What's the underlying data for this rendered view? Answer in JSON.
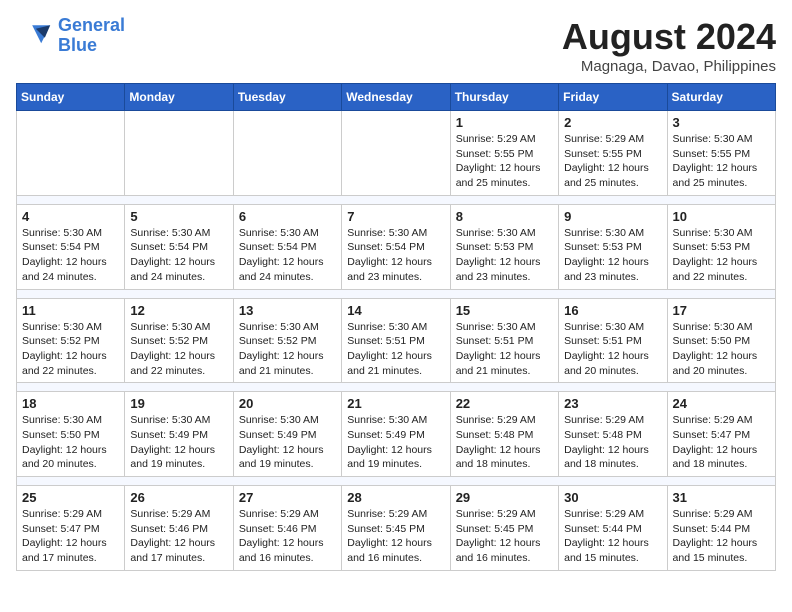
{
  "header": {
    "logo_line1": "General",
    "logo_line2": "Blue",
    "month_year": "August 2024",
    "location": "Magnaga, Davao, Philippines"
  },
  "weekdays": [
    "Sunday",
    "Monday",
    "Tuesday",
    "Wednesday",
    "Thursday",
    "Friday",
    "Saturday"
  ],
  "weeks": [
    {
      "days": [
        {
          "num": "",
          "info": ""
        },
        {
          "num": "",
          "info": ""
        },
        {
          "num": "",
          "info": ""
        },
        {
          "num": "",
          "info": ""
        },
        {
          "num": "1",
          "info": "Sunrise: 5:29 AM\nSunset: 5:55 PM\nDaylight: 12 hours\nand 25 minutes."
        },
        {
          "num": "2",
          "info": "Sunrise: 5:29 AM\nSunset: 5:55 PM\nDaylight: 12 hours\nand 25 minutes."
        },
        {
          "num": "3",
          "info": "Sunrise: 5:30 AM\nSunset: 5:55 PM\nDaylight: 12 hours\nand 25 minutes."
        }
      ]
    },
    {
      "days": [
        {
          "num": "4",
          "info": "Sunrise: 5:30 AM\nSunset: 5:54 PM\nDaylight: 12 hours\nand 24 minutes."
        },
        {
          "num": "5",
          "info": "Sunrise: 5:30 AM\nSunset: 5:54 PM\nDaylight: 12 hours\nand 24 minutes."
        },
        {
          "num": "6",
          "info": "Sunrise: 5:30 AM\nSunset: 5:54 PM\nDaylight: 12 hours\nand 24 minutes."
        },
        {
          "num": "7",
          "info": "Sunrise: 5:30 AM\nSunset: 5:54 PM\nDaylight: 12 hours\nand 23 minutes."
        },
        {
          "num": "8",
          "info": "Sunrise: 5:30 AM\nSunset: 5:53 PM\nDaylight: 12 hours\nand 23 minutes."
        },
        {
          "num": "9",
          "info": "Sunrise: 5:30 AM\nSunset: 5:53 PM\nDaylight: 12 hours\nand 23 minutes."
        },
        {
          "num": "10",
          "info": "Sunrise: 5:30 AM\nSunset: 5:53 PM\nDaylight: 12 hours\nand 22 minutes."
        }
      ]
    },
    {
      "days": [
        {
          "num": "11",
          "info": "Sunrise: 5:30 AM\nSunset: 5:52 PM\nDaylight: 12 hours\nand 22 minutes."
        },
        {
          "num": "12",
          "info": "Sunrise: 5:30 AM\nSunset: 5:52 PM\nDaylight: 12 hours\nand 22 minutes."
        },
        {
          "num": "13",
          "info": "Sunrise: 5:30 AM\nSunset: 5:52 PM\nDaylight: 12 hours\nand 21 minutes."
        },
        {
          "num": "14",
          "info": "Sunrise: 5:30 AM\nSunset: 5:51 PM\nDaylight: 12 hours\nand 21 minutes."
        },
        {
          "num": "15",
          "info": "Sunrise: 5:30 AM\nSunset: 5:51 PM\nDaylight: 12 hours\nand 21 minutes."
        },
        {
          "num": "16",
          "info": "Sunrise: 5:30 AM\nSunset: 5:51 PM\nDaylight: 12 hours\nand 20 minutes."
        },
        {
          "num": "17",
          "info": "Sunrise: 5:30 AM\nSunset: 5:50 PM\nDaylight: 12 hours\nand 20 minutes."
        }
      ]
    },
    {
      "days": [
        {
          "num": "18",
          "info": "Sunrise: 5:30 AM\nSunset: 5:50 PM\nDaylight: 12 hours\nand 20 minutes."
        },
        {
          "num": "19",
          "info": "Sunrise: 5:30 AM\nSunset: 5:49 PM\nDaylight: 12 hours\nand 19 minutes."
        },
        {
          "num": "20",
          "info": "Sunrise: 5:30 AM\nSunset: 5:49 PM\nDaylight: 12 hours\nand 19 minutes."
        },
        {
          "num": "21",
          "info": "Sunrise: 5:30 AM\nSunset: 5:49 PM\nDaylight: 12 hours\nand 19 minutes."
        },
        {
          "num": "22",
          "info": "Sunrise: 5:29 AM\nSunset: 5:48 PM\nDaylight: 12 hours\nand 18 minutes."
        },
        {
          "num": "23",
          "info": "Sunrise: 5:29 AM\nSunset: 5:48 PM\nDaylight: 12 hours\nand 18 minutes."
        },
        {
          "num": "24",
          "info": "Sunrise: 5:29 AM\nSunset: 5:47 PM\nDaylight: 12 hours\nand 18 minutes."
        }
      ]
    },
    {
      "days": [
        {
          "num": "25",
          "info": "Sunrise: 5:29 AM\nSunset: 5:47 PM\nDaylight: 12 hours\nand 17 minutes."
        },
        {
          "num": "26",
          "info": "Sunrise: 5:29 AM\nSunset: 5:46 PM\nDaylight: 12 hours\nand 17 minutes."
        },
        {
          "num": "27",
          "info": "Sunrise: 5:29 AM\nSunset: 5:46 PM\nDaylight: 12 hours\nand 16 minutes."
        },
        {
          "num": "28",
          "info": "Sunrise: 5:29 AM\nSunset: 5:45 PM\nDaylight: 12 hours\nand 16 minutes."
        },
        {
          "num": "29",
          "info": "Sunrise: 5:29 AM\nSunset: 5:45 PM\nDaylight: 12 hours\nand 16 minutes."
        },
        {
          "num": "30",
          "info": "Sunrise: 5:29 AM\nSunset: 5:44 PM\nDaylight: 12 hours\nand 15 minutes."
        },
        {
          "num": "31",
          "info": "Sunrise: 5:29 AM\nSunset: 5:44 PM\nDaylight: 12 hours\nand 15 minutes."
        }
      ]
    }
  ]
}
